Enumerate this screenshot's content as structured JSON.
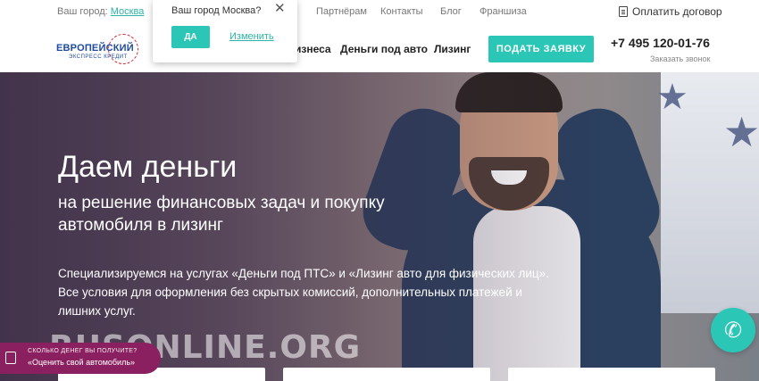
{
  "topbar": {
    "city_label": "Ваш город:",
    "city_value": "Москва",
    "nav": [
      {
        "label": "Партнёрам"
      },
      {
        "label": "Контакты"
      },
      {
        "label": "Блог"
      },
      {
        "label": "Франшиза"
      }
    ],
    "contract": "Оплатить договор"
  },
  "logo": {
    "brand": "ЕВРОПЕЙСКИЙ",
    "sub": "ЭКСПРЕСС КРЕДИТ"
  },
  "nav": {
    "items": [
      {
        "label": "изнеса"
      },
      {
        "label": "Деньги под авто"
      },
      {
        "label": "Лизинг"
      }
    ],
    "apply_label": "ПОДАТЬ ЗАЯВКУ",
    "phone": "+7 495 120-01-76",
    "callback": "Заказать звонок"
  },
  "hero": {
    "title": "Даем деньги",
    "subtitle": "на решение финансовых задач и покупку автомобиля в лизинг",
    "description": "Специализируемся на услугах «Деньги под ПТС» и «Лизинг авто для физических лиц». Все условия для оформления без скрытых комиссий, дополнительных платежей и лишних услуг."
  },
  "popup": {
    "question": "Ваш город Москва?",
    "yes_label": "ДА",
    "change_label": "Изменить"
  },
  "eval_widget": {
    "line1": "СКОЛЬКО ДЕНЕГ ВЫ ПОЛУЧИТЕ?",
    "line2": "«Оценить свой автомобиль»"
  },
  "watermark": "RUSONLINE.ORG",
  "colors": {
    "accent": "#2bc6b6",
    "brand": "#1e4aa0",
    "widget": "#8a2060"
  }
}
